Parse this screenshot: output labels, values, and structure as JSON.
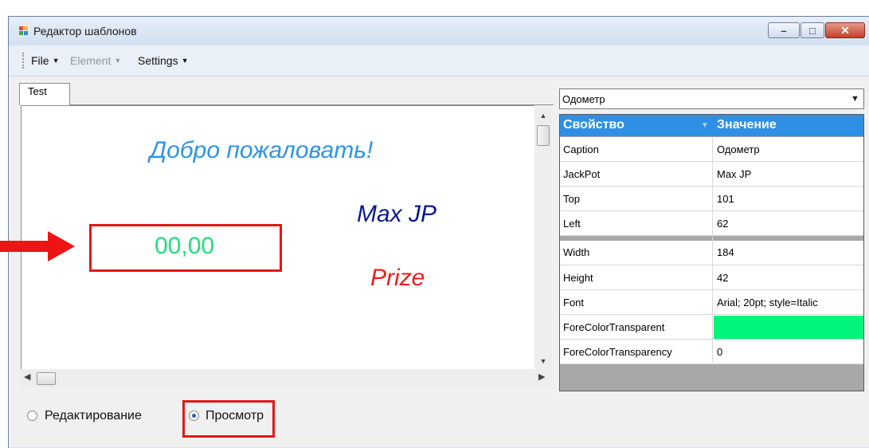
{
  "window": {
    "title": "Редактор шаблонов",
    "icon": "app-icon",
    "controls": {
      "minimize": "–",
      "maximize": "□",
      "close": "✕"
    }
  },
  "menu": [
    {
      "label": "File",
      "enabled": true
    },
    {
      "label": "Element",
      "enabled": false
    },
    {
      "label": "Settings",
      "enabled": true
    }
  ],
  "tabs": [
    {
      "label": "Test",
      "selected": true
    }
  ],
  "canvas": {
    "welcome_text": "Добро пожаловать!",
    "jackpot_text": "Max JP",
    "prize_text": "Prize",
    "odometer_value": "00,00"
  },
  "element_select": {
    "value": "Одометр"
  },
  "property_grid": {
    "header": {
      "property": "Свойство",
      "value": "Значение"
    },
    "rows": [
      {
        "name": "Caption",
        "value": "Одометр"
      },
      {
        "name": "JackPot",
        "value": "Max JP"
      },
      {
        "name": "Top",
        "value": "101"
      },
      {
        "name": "Left",
        "value": "62"
      },
      {
        "name": "Width",
        "value": "184"
      },
      {
        "name": "Height",
        "value": "42"
      },
      {
        "name": "Font",
        "value": "Arial; 20pt; style=Italic"
      },
      {
        "name": "ForeColorTransparent",
        "value": ""
      },
      {
        "name": "ForeColorTransparency",
        "value": "0"
      }
    ],
    "swatch_color": "#00f57a"
  },
  "mode": {
    "edit_label": "Редактирование",
    "view_label": "Просмотр",
    "selected": "view"
  },
  "colors": {
    "welcome": "#2e94e8",
    "jackpot": "#0b1892",
    "prize": "#ee1b1b",
    "odometer": "#1fe07a",
    "annotation": "#e01818",
    "grid_header": "#2f8fe4"
  }
}
